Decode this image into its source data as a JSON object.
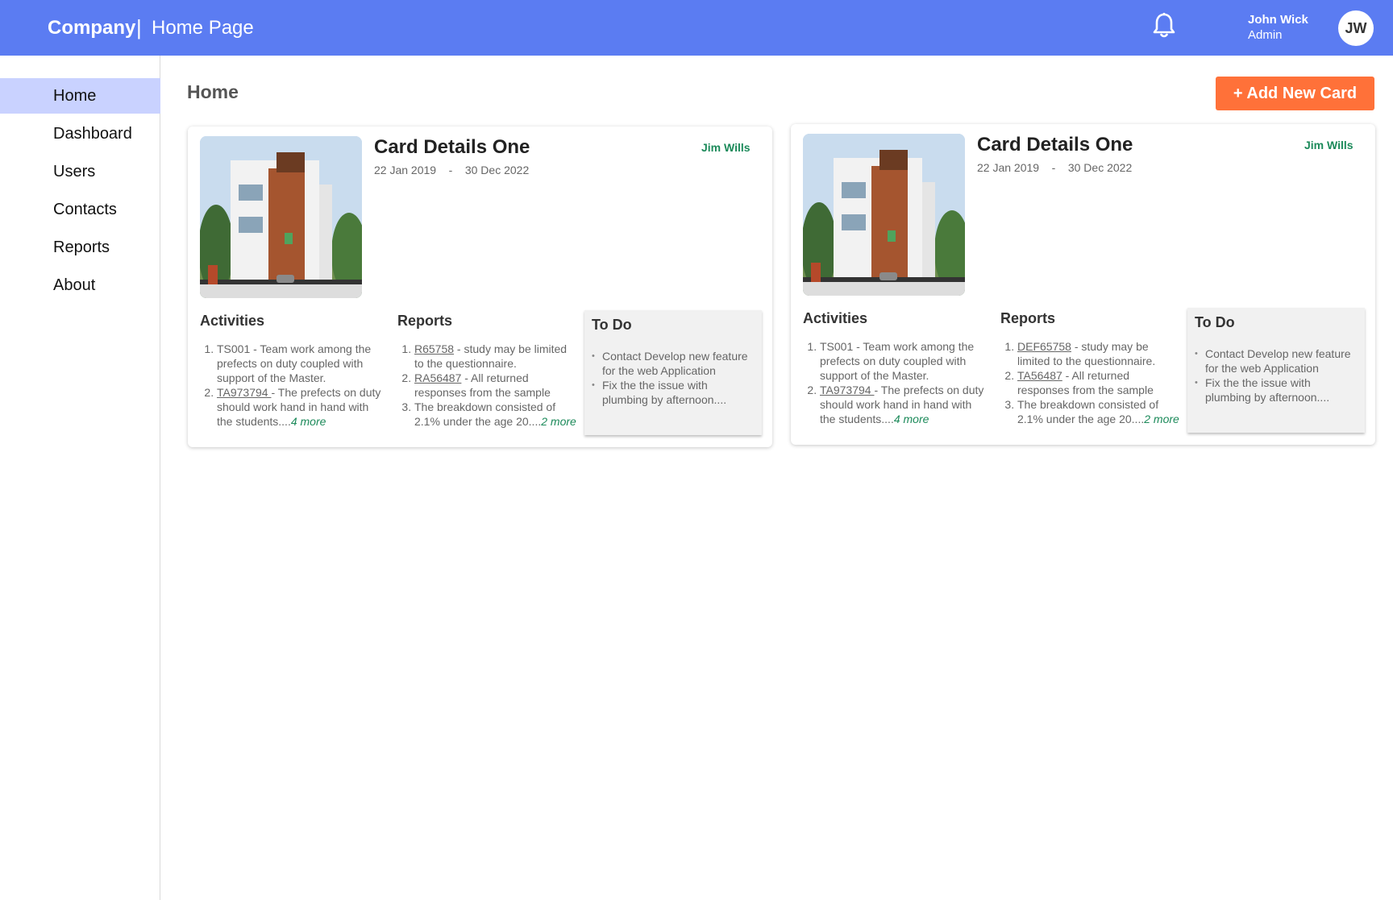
{
  "header": {
    "brand": "Company",
    "separator": "|",
    "page": "Home Page",
    "bell_icon": "bell-icon",
    "user": {
      "name": "John Wick",
      "role": "Admin",
      "initials": "JW"
    }
  },
  "sidebar": {
    "items": [
      {
        "label": "Home",
        "active": true
      },
      {
        "label": "Dashboard",
        "active": false
      },
      {
        "label": "Users",
        "active": false
      },
      {
        "label": "Contacts",
        "active": false
      },
      {
        "label": "Reports",
        "active": false
      },
      {
        "label": "About",
        "active": false
      }
    ]
  },
  "main": {
    "title": "Home",
    "add_button": "+ Add New Card"
  },
  "cards": [
    {
      "title": "Card Details One",
      "dates": "22 Jan 2019    -    30 Dec 2022",
      "owner": "Jim Wills",
      "activities": {
        "heading": "Activities",
        "items": [
          {
            "code": "",
            "text": "TS001 - Team work among the prefects on duty coupled with support of the Master.",
            "more": ""
          },
          {
            "code": "TA973794 ",
            "text": "- The prefects on duty should work hand in hand with the students....",
            "more": "4 more"
          }
        ]
      },
      "reports": {
        "heading": "Reports",
        "items": [
          {
            "code": "R65758",
            "text": " - study may be limited to the questionnaire.",
            "more": ""
          },
          {
            "code": "RA56487",
            "text": " - All returned responses from the sample",
            "more": ""
          },
          {
            "code": "",
            "text": "The breakdown consisted of 2.1% under the age 20....",
            "more": "2 more"
          }
        ]
      },
      "todo": {
        "heading": "To Do",
        "items": [
          "Contact Develop new feature for the web Application",
          "Fix the the issue with plumbing by afternoon...."
        ]
      }
    },
    {
      "title": "Card Details One",
      "dates": "22 Jan 2019    -    30 Dec 2022",
      "owner": "Jim Wills",
      "activities": {
        "heading": "Activities",
        "items": [
          {
            "code": "",
            "text": "TS001 - Team work among the prefects on duty coupled with support of the Master.",
            "more": ""
          },
          {
            "code": "TA973794 ",
            "text": "- The prefects on duty should work hand in hand with the students....",
            "more": "4 more"
          }
        ]
      },
      "reports": {
        "heading": "Reports",
        "items": [
          {
            "code": "DEF65758",
            "text": " - study may be limited to the questionnaire.",
            "more": ""
          },
          {
            "code": "TA56487",
            "text": " - All returned responses from the sample",
            "more": ""
          },
          {
            "code": "",
            "text": "The breakdown consisted of 2.1% under the age 20....",
            "more": "2 more"
          }
        ]
      },
      "todo": {
        "heading": "To Do",
        "items": [
          "Contact Develop new feature for the web Application",
          "Fix the the issue with plumbing by afternoon...."
        ]
      }
    }
  ]
}
